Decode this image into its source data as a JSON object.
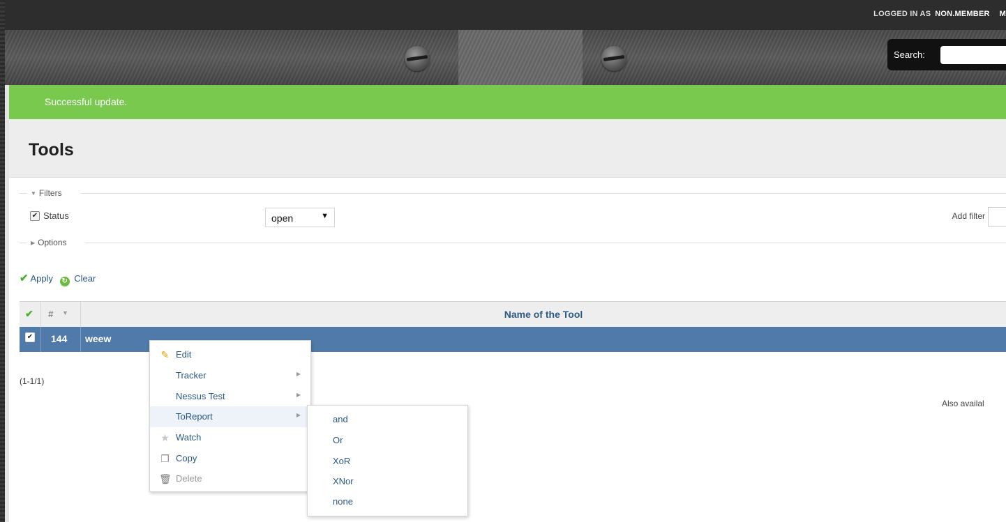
{
  "topbar": {
    "logged_in_label": "LOGGED IN AS",
    "username": "NON.MEMBER",
    "trailing": "M"
  },
  "header": {
    "search_label": "Search:",
    "search_value": ""
  },
  "flash": {
    "message": "Successful update."
  },
  "page": {
    "title": "Tools"
  },
  "filters": {
    "legend": "Filters",
    "status_label": "Status",
    "status_value": "open",
    "add_filter_label": "Add filter",
    "options_legend": "Options"
  },
  "actions": {
    "apply": "Apply",
    "clear": "Clear"
  },
  "table": {
    "col_hash": "#",
    "col_name": "Name of the Tool",
    "rows": [
      {
        "id": "144",
        "name": "weew"
      }
    ]
  },
  "pagination": "(1-1/1)",
  "also_available": "Also availal",
  "context_menu": {
    "items": [
      {
        "label": "Edit",
        "icon": "pencil-icon"
      },
      {
        "label": "Tracker",
        "has_submenu": true
      },
      {
        "label": "Nessus Test",
        "has_submenu": true
      },
      {
        "label": "ToReport",
        "has_submenu": true
      },
      {
        "label": "Watch",
        "icon": "star-icon"
      },
      {
        "label": "Copy",
        "icon": "copy-icon"
      },
      {
        "label": "Delete",
        "icon": "trash-icon"
      }
    ],
    "submenu": [
      "and",
      "Or",
      "XoR",
      "XNor",
      "none"
    ]
  },
  "colors": {
    "flash_bg": "#78c94e",
    "selected_row": "#507aaa",
    "link": "#2a5885",
    "topbar": "#2d2d2d"
  }
}
